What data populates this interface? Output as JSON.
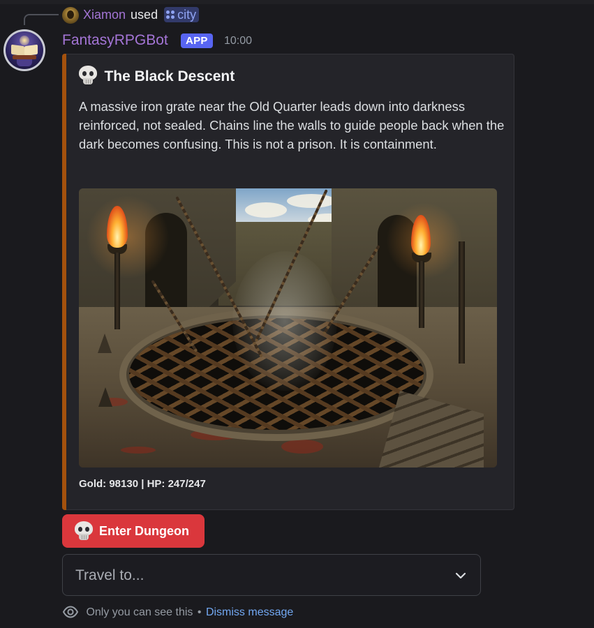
{
  "reply": {
    "user": "Xiamon",
    "used": "used",
    "command": "city"
  },
  "message": {
    "bot_name": "FantasyRPGBot",
    "badge": "APP",
    "time": "10:00"
  },
  "embed": {
    "accent_color": "#a4510d",
    "title_icon": "skull-icon",
    "title": "The Black Descent",
    "description": "A massive iron grate near the Old Quarter leads down into darkness reinforced, not sealed. Chains line the walls to guide people back when the dark becomes confusing. This is not a prison. It is containment.",
    "footer": "Gold: 98130 | HP: 247/247"
  },
  "actions": {
    "enter_button": {
      "icon": "skull-icon",
      "label": "Enter Dungeon",
      "color": "#da373c"
    },
    "travel_select": {
      "placeholder": "Travel to..."
    }
  },
  "ephemeral": {
    "icon": "eye-icon",
    "text": "Only you can see this",
    "separator": "•",
    "dismiss": "Dismiss message"
  }
}
